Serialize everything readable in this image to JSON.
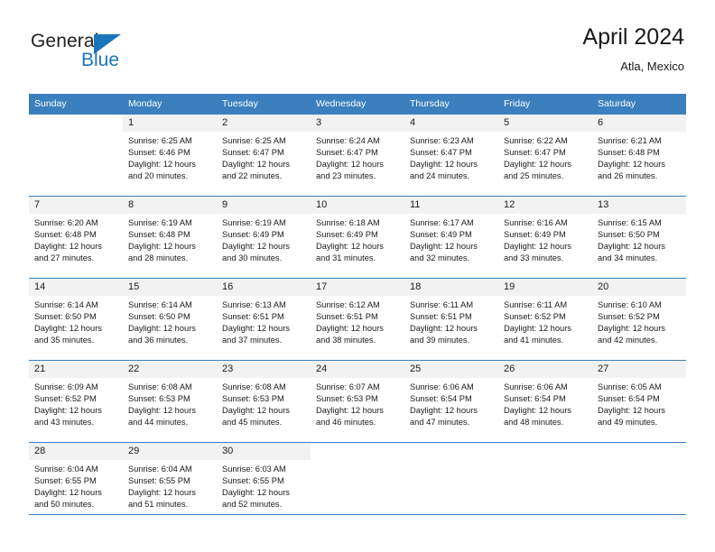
{
  "brand": {
    "name_part1": "General",
    "name_part2": "Blue",
    "triangle_color": "#1b75bb",
    "text_color": "#231f20"
  },
  "header": {
    "title": "April 2024",
    "subtitle": "Atla, Mexico"
  },
  "theme": {
    "header_row_bg": "#3b7fbf",
    "header_row_text": "#ffffff",
    "daynum_band_bg": "#f2f2f2",
    "cell_bg": "#ffffff",
    "grid_line": "#3b7fbf",
    "body_text": "#1a1a1a"
  },
  "weekday_headers": [
    "Sunday",
    "Monday",
    "Tuesday",
    "Wednesday",
    "Thursday",
    "Friday",
    "Saturday"
  ],
  "weeks": [
    [
      {
        "day": "",
        "lines": []
      },
      {
        "day": "1",
        "lines": [
          "Sunrise: 6:25 AM",
          "Sunset: 6:46 PM",
          "Daylight: 12 hours",
          "and 20 minutes."
        ]
      },
      {
        "day": "2",
        "lines": [
          "Sunrise: 6:25 AM",
          "Sunset: 6:47 PM",
          "Daylight: 12 hours",
          "and 22 minutes."
        ]
      },
      {
        "day": "3",
        "lines": [
          "Sunrise: 6:24 AM",
          "Sunset: 6:47 PM",
          "Daylight: 12 hours",
          "and 23 minutes."
        ]
      },
      {
        "day": "4",
        "lines": [
          "Sunrise: 6:23 AM",
          "Sunset: 6:47 PM",
          "Daylight: 12 hours",
          "and 24 minutes."
        ]
      },
      {
        "day": "5",
        "lines": [
          "Sunrise: 6:22 AM",
          "Sunset: 6:47 PM",
          "Daylight: 12 hours",
          "and 25 minutes."
        ]
      },
      {
        "day": "6",
        "lines": [
          "Sunrise: 6:21 AM",
          "Sunset: 6:48 PM",
          "Daylight: 12 hours",
          "and 26 minutes."
        ]
      }
    ],
    [
      {
        "day": "7",
        "lines": [
          "Sunrise: 6:20 AM",
          "Sunset: 6:48 PM",
          "Daylight: 12 hours",
          "and 27 minutes."
        ]
      },
      {
        "day": "8",
        "lines": [
          "Sunrise: 6:19 AM",
          "Sunset: 6:48 PM",
          "Daylight: 12 hours",
          "and 28 minutes."
        ]
      },
      {
        "day": "9",
        "lines": [
          "Sunrise: 6:19 AM",
          "Sunset: 6:49 PM",
          "Daylight: 12 hours",
          "and 30 minutes."
        ]
      },
      {
        "day": "10",
        "lines": [
          "Sunrise: 6:18 AM",
          "Sunset: 6:49 PM",
          "Daylight: 12 hours",
          "and 31 minutes."
        ]
      },
      {
        "day": "11",
        "lines": [
          "Sunrise: 6:17 AM",
          "Sunset: 6:49 PM",
          "Daylight: 12 hours",
          "and 32 minutes."
        ]
      },
      {
        "day": "12",
        "lines": [
          "Sunrise: 6:16 AM",
          "Sunset: 6:49 PM",
          "Daylight: 12 hours",
          "and 33 minutes."
        ]
      },
      {
        "day": "13",
        "lines": [
          "Sunrise: 6:15 AM",
          "Sunset: 6:50 PM",
          "Daylight: 12 hours",
          "and 34 minutes."
        ]
      }
    ],
    [
      {
        "day": "14",
        "lines": [
          "Sunrise: 6:14 AM",
          "Sunset: 6:50 PM",
          "Daylight: 12 hours",
          "and 35 minutes."
        ]
      },
      {
        "day": "15",
        "lines": [
          "Sunrise: 6:14 AM",
          "Sunset: 6:50 PM",
          "Daylight: 12 hours",
          "and 36 minutes."
        ]
      },
      {
        "day": "16",
        "lines": [
          "Sunrise: 6:13 AM",
          "Sunset: 6:51 PM",
          "Daylight: 12 hours",
          "and 37 minutes."
        ]
      },
      {
        "day": "17",
        "lines": [
          "Sunrise: 6:12 AM",
          "Sunset: 6:51 PM",
          "Daylight: 12 hours",
          "and 38 minutes."
        ]
      },
      {
        "day": "18",
        "lines": [
          "Sunrise: 6:11 AM",
          "Sunset: 6:51 PM",
          "Daylight: 12 hours",
          "and 39 minutes."
        ]
      },
      {
        "day": "19",
        "lines": [
          "Sunrise: 6:11 AM",
          "Sunset: 6:52 PM",
          "Daylight: 12 hours",
          "and 41 minutes."
        ]
      },
      {
        "day": "20",
        "lines": [
          "Sunrise: 6:10 AM",
          "Sunset: 6:52 PM",
          "Daylight: 12 hours",
          "and 42 minutes."
        ]
      }
    ],
    [
      {
        "day": "21",
        "lines": [
          "Sunrise: 6:09 AM",
          "Sunset: 6:52 PM",
          "Daylight: 12 hours",
          "and 43 minutes."
        ]
      },
      {
        "day": "22",
        "lines": [
          "Sunrise: 6:08 AM",
          "Sunset: 6:53 PM",
          "Daylight: 12 hours",
          "and 44 minutes."
        ]
      },
      {
        "day": "23",
        "lines": [
          "Sunrise: 6:08 AM",
          "Sunset: 6:53 PM",
          "Daylight: 12 hours",
          "and 45 minutes."
        ]
      },
      {
        "day": "24",
        "lines": [
          "Sunrise: 6:07 AM",
          "Sunset: 6:53 PM",
          "Daylight: 12 hours",
          "and 46 minutes."
        ]
      },
      {
        "day": "25",
        "lines": [
          "Sunrise: 6:06 AM",
          "Sunset: 6:54 PM",
          "Daylight: 12 hours",
          "and 47 minutes."
        ]
      },
      {
        "day": "26",
        "lines": [
          "Sunrise: 6:06 AM",
          "Sunset: 6:54 PM",
          "Daylight: 12 hours",
          "and 48 minutes."
        ]
      },
      {
        "day": "27",
        "lines": [
          "Sunrise: 6:05 AM",
          "Sunset: 6:54 PM",
          "Daylight: 12 hours",
          "and 49 minutes."
        ]
      }
    ],
    [
      {
        "day": "28",
        "lines": [
          "Sunrise: 6:04 AM",
          "Sunset: 6:55 PM",
          "Daylight: 12 hours",
          "and 50 minutes."
        ]
      },
      {
        "day": "29",
        "lines": [
          "Sunrise: 6:04 AM",
          "Sunset: 6:55 PM",
          "Daylight: 12 hours",
          "and 51 minutes."
        ]
      },
      {
        "day": "30",
        "lines": [
          "Sunrise: 6:03 AM",
          "Sunset: 6:55 PM",
          "Daylight: 12 hours",
          "and 52 minutes."
        ]
      },
      {
        "day": "",
        "lines": []
      },
      {
        "day": "",
        "lines": []
      },
      {
        "day": "",
        "lines": []
      },
      {
        "day": "",
        "lines": []
      }
    ]
  ]
}
